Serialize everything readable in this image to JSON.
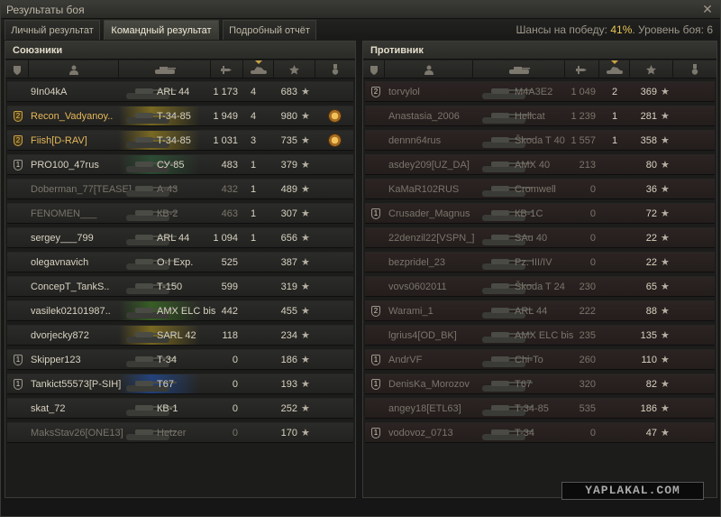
{
  "window": {
    "title": "Результаты боя",
    "close_glyph": "✕"
  },
  "tabs": [
    {
      "label": "Личный результат",
      "active": false
    },
    {
      "label": "Командный результат",
      "active": true
    },
    {
      "label": "Подробный отчёт",
      "active": false
    }
  ],
  "chance": {
    "prefix": "Шансы на победу:",
    "value": "41%",
    "suffix": ". Уровень боя: 6"
  },
  "icons": {
    "platoon": "shield-icon",
    "player": "user-icon",
    "tank": "tank-icon",
    "damage": "shell-icon",
    "kills": "destroyed-tank-icon",
    "xp": "star-icon",
    "medal": "medal-icon",
    "sort": "sort-arrow-icon"
  },
  "colors": {
    "lt": "#3f7a24",
    "mt": "#a38a1e",
    "ht": "#1f4fa8",
    "td": "#2d5e3a",
    "spg": "#7a2a2a",
    "gold": "#e5b85a"
  },
  "teams": {
    "allies": {
      "title": "Союзники",
      "players": [
        {
          "platoon": "",
          "nick": "9In04kA",
          "tank": "ARL 44",
          "damage": "1 173",
          "kills": "4",
          "xp": "683",
          "medal": false,
          "alive": true,
          "hl": false,
          "cls": ""
        },
        {
          "platoon": "2",
          "nick": "Recon_Vadyanoy..",
          "tank": "T-34-85",
          "damage": "1 949",
          "kills": "4",
          "xp": "980",
          "medal": true,
          "alive": true,
          "hl": true,
          "cls": "mt"
        },
        {
          "platoon": "2",
          "nick": "Fiish[D-RAV]",
          "tank": "T-34-85",
          "damage": "1 031",
          "kills": "3",
          "xp": "735",
          "medal": true,
          "alive": true,
          "hl": true,
          "cls": "mt"
        },
        {
          "platoon": "1",
          "nick": "PRO100_47rus",
          "tank": "СУ-85",
          "damage": "483",
          "kills": "1",
          "xp": "379",
          "medal": false,
          "alive": true,
          "hl": false,
          "cls": "td"
        },
        {
          "platoon": "",
          "nick": "Doberman_77[TEASE]",
          "tank": "A-43",
          "damage": "432",
          "kills": "1",
          "xp": "489",
          "medal": false,
          "alive": false,
          "hl": false,
          "cls": ""
        },
        {
          "platoon": "",
          "nick": "FENOMEN___",
          "tank": "КВ-2",
          "damage": "463",
          "kills": "1",
          "xp": "307",
          "medal": false,
          "alive": false,
          "hl": false,
          "cls": ""
        },
        {
          "platoon": "",
          "nick": "sergey___799",
          "tank": "ARL 44",
          "damage": "1 094",
          "kills": "1",
          "xp": "656",
          "medal": false,
          "alive": true,
          "hl": false,
          "cls": ""
        },
        {
          "platoon": "",
          "nick": "olegavnavich",
          "tank": "O-I Exp.",
          "damage": "525",
          "kills": "",
          "xp": "387",
          "medal": false,
          "alive": true,
          "hl": false,
          "cls": ""
        },
        {
          "platoon": "",
          "nick": "ConcepT_TankS..",
          "tank": "T-150",
          "damage": "599",
          "kills": "",
          "xp": "319",
          "medal": false,
          "alive": true,
          "hl": false,
          "cls": ""
        },
        {
          "platoon": "",
          "nick": "vasilek02101987..",
          "tank": "AMX ELC bis",
          "damage": "442",
          "kills": "",
          "xp": "455",
          "medal": false,
          "alive": true,
          "hl": false,
          "cls": "lt"
        },
        {
          "platoon": "",
          "nick": "dvorjecky872",
          "tank": "SARL 42",
          "damage": "118",
          "kills": "",
          "xp": "234",
          "medal": false,
          "alive": true,
          "hl": false,
          "cls": "mt"
        },
        {
          "platoon": "1",
          "nick": "Skipper123",
          "tank": "T-34",
          "damage": "0",
          "kills": "",
          "xp": "186",
          "medal": false,
          "alive": true,
          "hl": false,
          "cls": ""
        },
        {
          "platoon": "1",
          "nick": "Tankict55573[P-SIH]",
          "tank": "T67",
          "damage": "0",
          "kills": "",
          "xp": "193",
          "medal": false,
          "alive": true,
          "hl": false,
          "cls": "ht"
        },
        {
          "platoon": "",
          "nick": "skat_72",
          "tank": "КВ-1",
          "damage": "0",
          "kills": "",
          "xp": "252",
          "medal": false,
          "alive": true,
          "hl": false,
          "cls": ""
        },
        {
          "platoon": "",
          "nick": "MaksStav26[ONE13]",
          "tank": "Hetzer",
          "damage": "0",
          "kills": "",
          "xp": "170",
          "medal": false,
          "alive": false,
          "hl": false,
          "cls": ""
        }
      ]
    },
    "enemies": {
      "title": "Противник",
      "players": [
        {
          "platoon": "2",
          "nick": "torvylol",
          "tank": "M4A3E2",
          "damage": "1 049",
          "kills": "2",
          "xp": "369",
          "medal": false,
          "alive": false,
          "hl": false,
          "cls": ""
        },
        {
          "platoon": "",
          "nick": "Anastasia_2006",
          "tank": "Hellcat",
          "damage": "1 239",
          "kills": "1",
          "xp": "281",
          "medal": false,
          "alive": false,
          "hl": false,
          "cls": ""
        },
        {
          "platoon": "",
          "nick": "dennn64rus",
          "tank": "Škoda T 40",
          "damage": "1 557",
          "kills": "1",
          "xp": "358",
          "medal": false,
          "alive": false,
          "hl": false,
          "cls": ""
        },
        {
          "platoon": "",
          "nick": "asdey209[UZ_DA]",
          "tank": "AMX 40",
          "damage": "213",
          "kills": "",
          "xp": "80",
          "medal": false,
          "alive": false,
          "hl": false,
          "cls": ""
        },
        {
          "platoon": "",
          "nick": "KaMaR102RUS",
          "tank": "Cromwell",
          "damage": "0",
          "kills": "",
          "xp": "36",
          "medal": false,
          "alive": false,
          "hl": false,
          "cls": ""
        },
        {
          "platoon": "1",
          "nick": "Crusader_Magnus",
          "tank": "КВ-1С",
          "damage": "0",
          "kills": "",
          "xp": "72",
          "medal": false,
          "alive": false,
          "hl": false,
          "cls": ""
        },
        {
          "platoon": "",
          "nick": "22denzil22[VSPN_]",
          "tank": "SAu 40",
          "damage": "0",
          "kills": "",
          "xp": "22",
          "medal": false,
          "alive": false,
          "hl": false,
          "cls": ""
        },
        {
          "platoon": "",
          "nick": "bezpridel_23",
          "tank": "Pz. III/IV",
          "damage": "0",
          "kills": "",
          "xp": "22",
          "medal": false,
          "alive": false,
          "hl": false,
          "cls": ""
        },
        {
          "platoon": "",
          "nick": "vovs0602011",
          "tank": "Škoda T 24",
          "damage": "230",
          "kills": "",
          "xp": "65",
          "medal": false,
          "alive": false,
          "hl": false,
          "cls": ""
        },
        {
          "platoon": "2",
          "nick": "Warami_1",
          "tank": "ARL 44",
          "damage": "222",
          "kills": "",
          "xp": "88",
          "medal": false,
          "alive": false,
          "hl": false,
          "cls": ""
        },
        {
          "platoon": "",
          "nick": "lgrius4[OD_BK]",
          "tank": "AMX ELC bis",
          "damage": "235",
          "kills": "",
          "xp": "135",
          "medal": false,
          "alive": false,
          "hl": false,
          "cls": ""
        },
        {
          "platoon": "1",
          "nick": "AndrVF",
          "tank": "Chi-To",
          "damage": "260",
          "kills": "",
          "xp": "110",
          "medal": false,
          "alive": false,
          "hl": false,
          "cls": ""
        },
        {
          "platoon": "1",
          "nick": "DenisKa_Morozov",
          "tank": "T67",
          "damage": "320",
          "kills": "",
          "xp": "82",
          "medal": false,
          "alive": false,
          "hl": false,
          "cls": ""
        },
        {
          "platoon": "",
          "nick": "angey18[ETL63]",
          "tank": "T-34-85",
          "damage": "535",
          "kills": "",
          "xp": "186",
          "medal": false,
          "alive": false,
          "hl": false,
          "cls": ""
        },
        {
          "platoon": "1",
          "nick": "vodovoz_0713",
          "tank": "T-34",
          "damage": "0",
          "kills": "",
          "xp": "47",
          "medal": false,
          "alive": false,
          "hl": false,
          "cls": ""
        }
      ]
    }
  },
  "watermark": "YAPLAKAL.COM"
}
